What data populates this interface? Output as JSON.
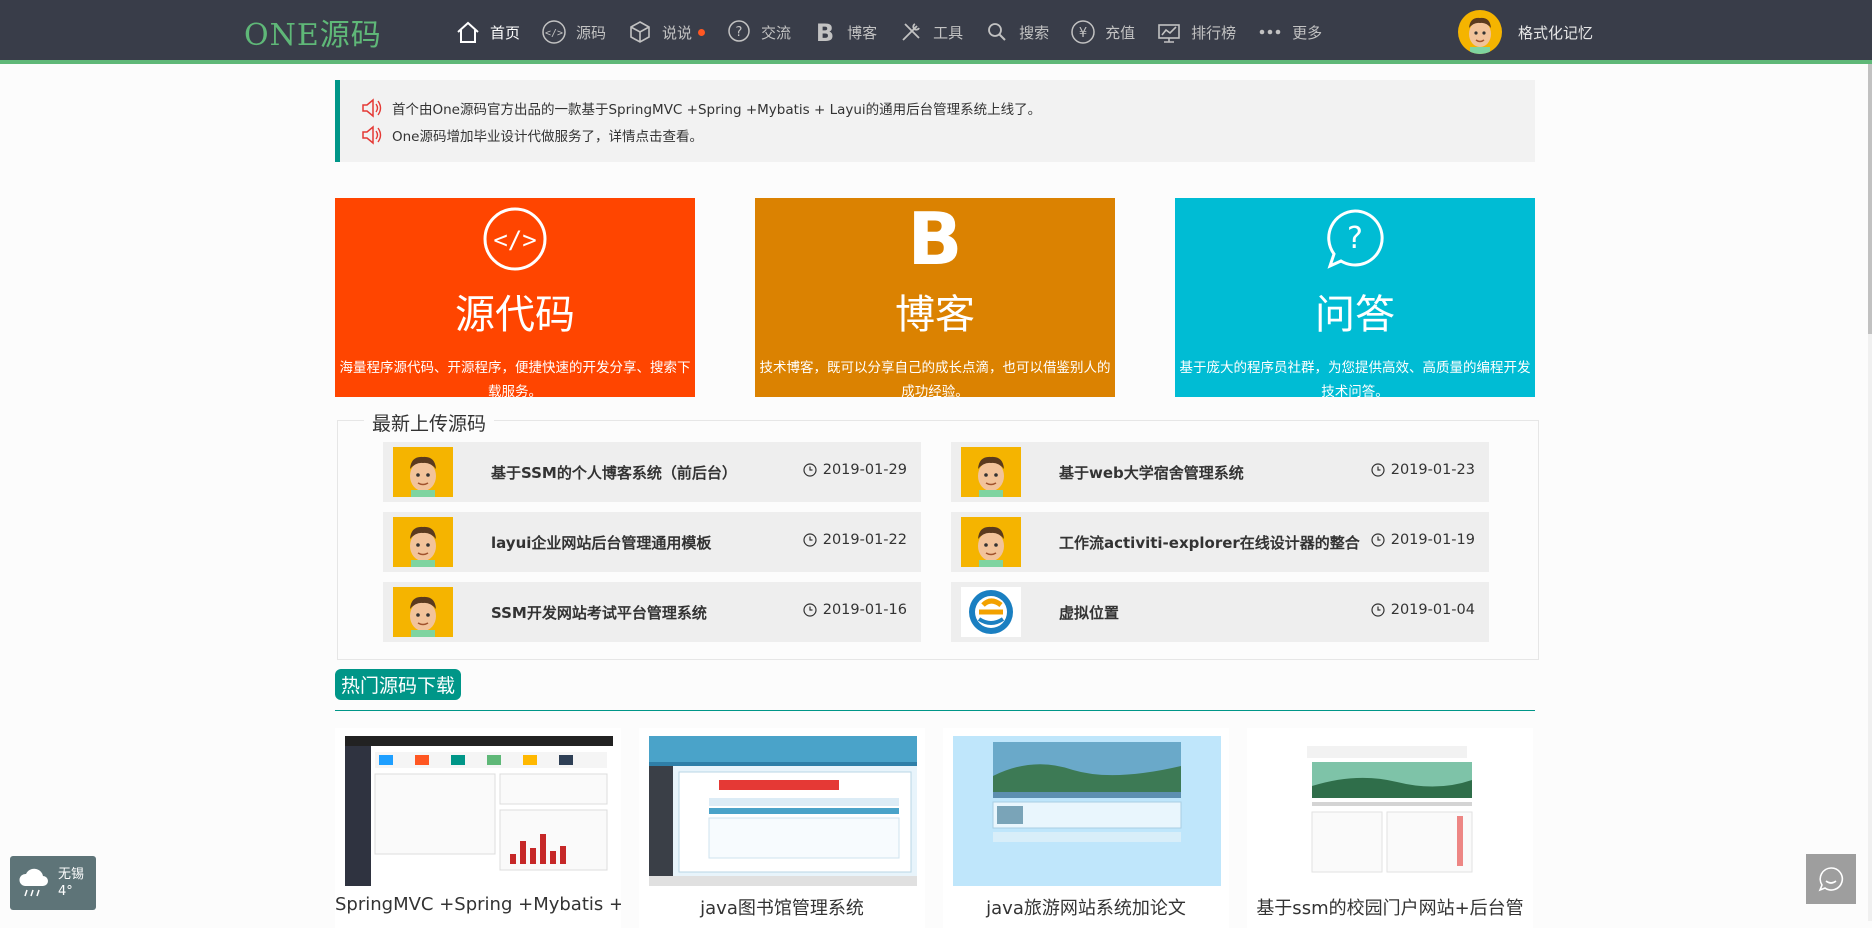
{
  "header": {
    "logo": "ONE源码",
    "nav": [
      {
        "label": "首页",
        "icon": "home-icon"
      },
      {
        "label": "源码",
        "icon": "code-icon"
      },
      {
        "label": "说说",
        "icon": "cube-icon"
      },
      {
        "label": "交流",
        "icon": "question-icon"
      },
      {
        "label": "博客",
        "icon": "blog-b-icon"
      },
      {
        "label": "工具",
        "icon": "tools-icon"
      },
      {
        "label": "搜索",
        "icon": "search-icon"
      },
      {
        "label": "充值",
        "icon": "yen-icon"
      },
      {
        "label": "排行榜",
        "icon": "ranking-icon"
      },
      {
        "label": "更多",
        "icon": "more-icon"
      }
    ],
    "user_name": "格式化记忆"
  },
  "notices": [
    "首个由One源码官方出品的一款基于SpringMVC +Spring +Mybatis + Layui的通用后台管理系统上线了。",
    "One源码增加毕业设计代做服务了，详情点击查看。"
  ],
  "cards": [
    {
      "title": "源代码",
      "desc": "海量程序源代码、开源程序，便捷快速的开发分享、搜索下载服务。",
      "color": "#ff4500"
    },
    {
      "title": "博客",
      "desc": "技术博客，既可以分享自己的成长点滴，也可以借鉴别人的成功经验。",
      "color": "#db8201"
    },
    {
      "title": "问答",
      "desc": "基于庞大的程序员社群，为您提供高效、高质量的编程开发技术问答。",
      "color": "#00bcd4"
    }
  ],
  "latest": {
    "title": "最新上传源码",
    "items": [
      {
        "title": "基于SSM的个人博客系统（前后台）",
        "date": "2019-01-29"
      },
      {
        "title": "基于web大学宿舍管理系统",
        "date": "2019-01-23"
      },
      {
        "title": "layui企业网站后台管理通用模板",
        "date": "2019-01-22"
      },
      {
        "title": "工作流activiti-explorer在线设计器的整合",
        "date": "2019-01-19"
      },
      {
        "title": "SSM开发网站考试平台管理系统",
        "date": "2019-01-16"
      },
      {
        "title": "虚拟位置",
        "date": "2019-01-04"
      }
    ]
  },
  "hot": {
    "title": "热门源码下载",
    "items": [
      {
        "caption": "SpringMVC +Spring +Mybatis +"
      },
      {
        "caption": "java图书馆管理系统"
      },
      {
        "caption": "java旅游网站系统加论文"
      },
      {
        "caption": "基于ssm的校园门户网站+后台管"
      }
    ]
  },
  "weather": {
    "city": "无锡",
    "temp": "4°"
  }
}
